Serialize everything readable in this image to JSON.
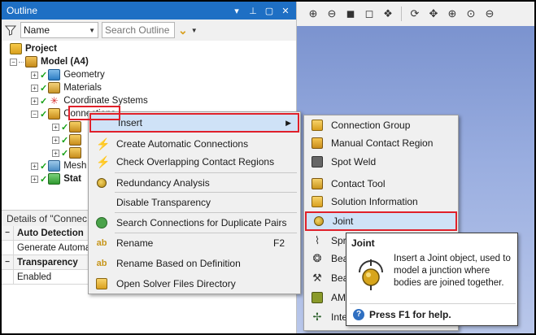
{
  "outline": {
    "title": "Outline",
    "header_buttons": [
      "▾",
      "⊥",
      "▢",
      "✕"
    ],
    "filter": {
      "name_value": "Name",
      "search_placeholder": "Search Outline"
    }
  },
  "tree": {
    "items": [
      {
        "label": "Project",
        "bold": true
      },
      {
        "label": "Model (A4)",
        "bold": true
      },
      {
        "label": "Geometry"
      },
      {
        "label": "Materials"
      },
      {
        "label": "Coordinate Systems"
      },
      {
        "label": "Connections"
      },
      {
        "label": "Mesh"
      },
      {
        "label": "Stat",
        "bold": true
      }
    ]
  },
  "details": {
    "title": "Details of \"Connec",
    "rows": [
      {
        "label": "Auto Detection",
        "section": true
      },
      {
        "label": "Generate Automa"
      },
      {
        "label": "Transparency",
        "section": true
      },
      {
        "label": "Enabled"
      }
    ]
  },
  "toolbar": {
    "buttons": [
      "zoom-in-icon",
      "zoom-out-icon",
      "cube-icon",
      "cube-wire-icon",
      "cube-multi-icon",
      "rotate-icon",
      "pan-icon",
      "zoom-box-icon",
      "zoom-fit-icon",
      "zoom-area-icon"
    ]
  },
  "context_menu": {
    "items": [
      {
        "label": "Insert",
        "arrow": "▶",
        "highlighted": true
      },
      {
        "label": "Create Automatic Connections"
      },
      {
        "label": "Check Overlapping Contact Regions"
      },
      {
        "label": "Redundancy Analysis"
      },
      {
        "label": "Disable Transparency"
      },
      {
        "label": "Search Connections for Duplicate Pairs"
      },
      {
        "label": "Rename",
        "shortcut": "F2"
      },
      {
        "label": "Rename Based on Definition"
      },
      {
        "label": "Open Solver Files Directory"
      }
    ]
  },
  "submenu": {
    "items": [
      {
        "label": "Connection Group"
      },
      {
        "label": "Manual Contact Region"
      },
      {
        "label": "Spot Weld"
      },
      {
        "label": "Contact Tool"
      },
      {
        "label": "Solution Information"
      },
      {
        "label": "Joint",
        "highlighted": true
      },
      {
        "label": "Spri"
      },
      {
        "label": "Bea"
      },
      {
        "label": "Bea"
      },
      {
        "label": "AM"
      },
      {
        "label": "Inte"
      }
    ]
  },
  "tooltip": {
    "title": "Joint",
    "text": "Insert a Joint object, used to model a junction where bodies are joined together.",
    "help": "Press F1 for help."
  },
  "colors": {
    "header_blue": "#1e6fc4",
    "highlight_fill": "#cfe2f7",
    "highlight_border": "#e0202a",
    "viewport_top": "#7b93cf",
    "viewport_bottom": "#b9c7ea"
  }
}
